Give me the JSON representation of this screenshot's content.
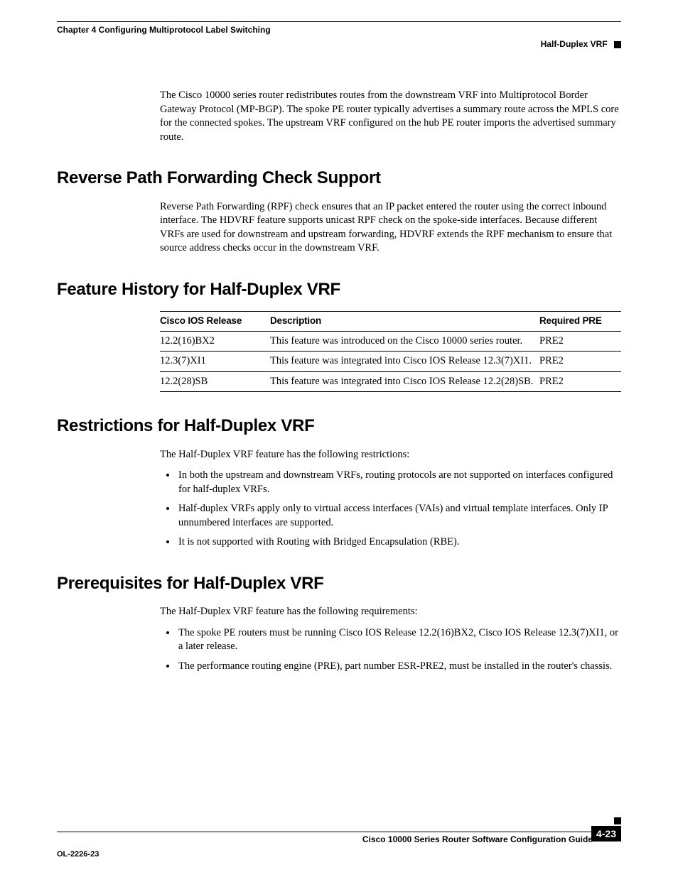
{
  "header": {
    "chapter": "Chapter 4      Configuring Multiprotocol Label Switching",
    "section": "Half-Duplex VRF"
  },
  "intro_para": "The Cisco 10000 series router redistributes routes from the downstream VRF into Multiprotocol Border Gateway Protocol (MP-BGP). The spoke PE router typically advertises a summary route across the MPLS core for the connected spokes. The upstream VRF configured on the hub PE router imports the advertised summary route.",
  "sections": {
    "rpf": {
      "title": "Reverse Path Forwarding Check Support",
      "para": "Reverse Path Forwarding (RPF) check ensures that an IP packet entered the router using the correct inbound interface. The HDVRF feature supports unicast RPF check on the spoke-side interfaces. Because different VRFs are used for downstream and upstream forwarding, HDVRF extends the RPF mechanism to ensure that source address checks occur in the downstream VRF."
    },
    "history": {
      "title": "Feature History for Half-Duplex VRF",
      "headers": {
        "c1": "Cisco IOS Release",
        "c2": "Description",
        "c3": "Required PRE"
      },
      "rows": [
        {
          "release": "12.2(16)BX2",
          "desc": "This feature was introduced on the Cisco 10000 series router.",
          "pre": "PRE2"
        },
        {
          "release": "12.3(7)XI1",
          "desc": "This feature was integrated into Cisco IOS Release 12.3(7)XI1.",
          "pre": "PRE2"
        },
        {
          "release": "12.2(28)SB",
          "desc": "This feature was integrated into Cisco IOS Release 12.2(28)SB.",
          "pre": "PRE2"
        }
      ]
    },
    "restrictions": {
      "title": "Restrictions for Half-Duplex VRF",
      "intro": "The Half-Duplex VRF feature has the following restrictions:",
      "items": [
        "In both the upstream and downstream VRFs, routing protocols are not supported on interfaces configured for half-duplex VRFs.",
        "Half-duplex VRFs apply only to virtual access interfaces (VAIs) and virtual template interfaces. Only IP unnumbered interfaces are supported.",
        "It is not supported with Routing with Bridged Encapsulation (RBE)."
      ]
    },
    "prereq": {
      "title": "Prerequisites for Half-Duplex VRF",
      "intro": "The Half-Duplex VRF feature has the following requirements:",
      "items": [
        "The spoke PE routers must be running Cisco IOS Release 12.2(16)BX2, Cisco IOS Release 12.3(7)XI1, or a later release.",
        "The performance routing engine (PRE), part number ESR-PRE2, must be installed in the router's chassis."
      ]
    }
  },
  "footer": {
    "guide": "Cisco 10000 Series Router Software Configuration Guide",
    "doc": "OL-2226-23",
    "page": "4-23"
  }
}
